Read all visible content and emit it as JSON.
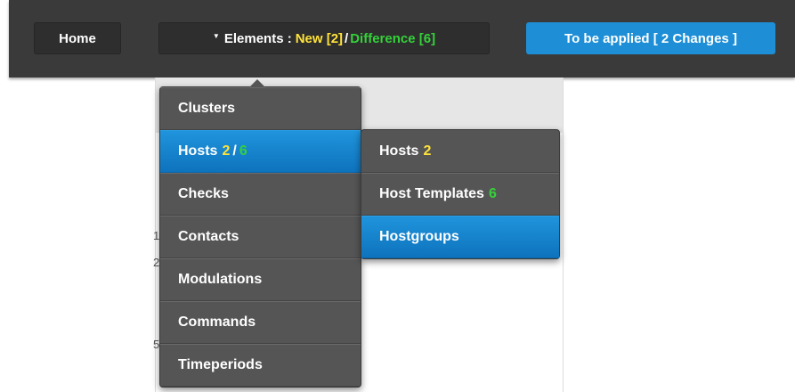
{
  "topbar": {
    "home_label": "Home",
    "elements": {
      "caret_icon": "caret-down-icon",
      "label": "Elements :",
      "new_label": "New [2]",
      "separator": "/",
      "difference_label": "Difference [6]"
    },
    "apply_label": "To be applied [ 2 Changes ]"
  },
  "background_fragments": [
    "1",
    "2",
    "5"
  ],
  "main_menu": {
    "items": [
      {
        "label": "Clusters"
      },
      {
        "label": "Hosts",
        "new_count": "2",
        "sep": "/",
        "diff_count": "6"
      },
      {
        "label": "Checks"
      },
      {
        "label": "Contacts"
      },
      {
        "label": "Modulations"
      },
      {
        "label": "Commands"
      },
      {
        "label": "Timeperiods"
      }
    ]
  },
  "sub_menu": {
    "items": [
      {
        "label": "Hosts",
        "count": "2"
      },
      {
        "label": "Host Templates",
        "count": "6"
      },
      {
        "label": "Hostgroups"
      }
    ]
  },
  "colors": {
    "new": "#ffe23a",
    "difference": "#35d13a",
    "accent": "#1e8fd6",
    "menu_bg": "#555555"
  }
}
